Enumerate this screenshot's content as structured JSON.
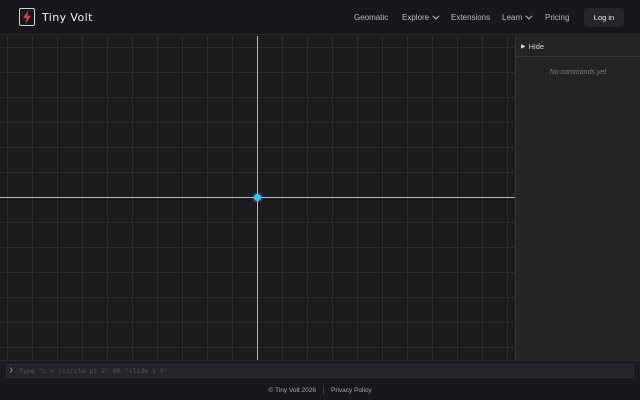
{
  "brand": {
    "name": "Tiny Volt",
    "logo_icon": "lightning-bolt-icon",
    "accent": "#e8394a"
  },
  "nav": {
    "items": [
      {
        "label": "Geomatic",
        "has_dropdown": false
      },
      {
        "label": "Explore",
        "has_dropdown": true
      },
      {
        "label": "Extensions",
        "has_dropdown": false
      },
      {
        "label": "Learn",
        "has_dropdown": true
      },
      {
        "label": "Pricing",
        "has_dropdown": false
      }
    ],
    "login_label": "Log in"
  },
  "panel": {
    "toggle_label": "Hide",
    "empty_text": "No commands yet"
  },
  "command": {
    "prompt": "❯",
    "placeholder": "Type \"c = (circle pt 2\" OR \"slide x 0\"",
    "value": ""
  },
  "footer": {
    "copyright": "© Tiny Volt 2026",
    "privacy_label": "Privacy Policy"
  },
  "canvas": {
    "point_color": "#3ec3ee",
    "axes_color": "#b8b9bd"
  }
}
